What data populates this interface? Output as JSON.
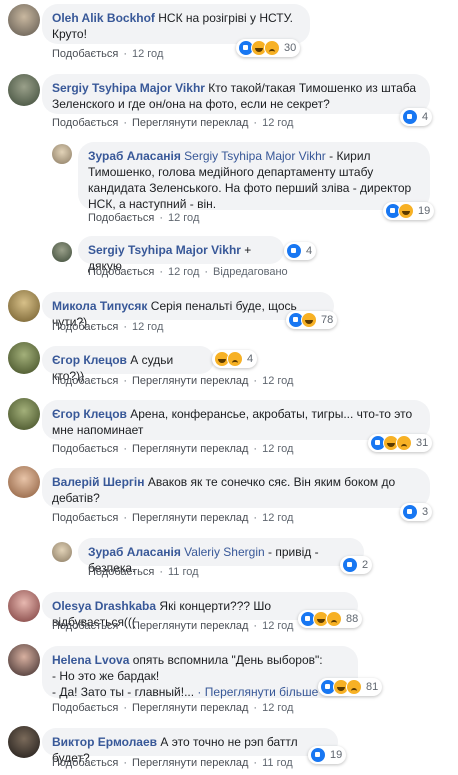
{
  "common": {
    "like": "Подобається",
    "translate": "Переглянути переклад",
    "dot": "·",
    "edited": "Відредаговано",
    "see_more": "Переглянути більше"
  },
  "colors": {
    "link": "#385898",
    "bubble": "#f2f3f5",
    "like": "#1877f2",
    "emoji": "#f7b125"
  },
  "comments": [
    {
      "author": "Oleh Alik Bockhof",
      "text1": "НСК на розігріві у НСТУ.",
      "text2": "Круто!",
      "time": "12 год",
      "reactions": "30",
      "icons": [
        "like-icon",
        "haha-icon",
        "sad-icon"
      ]
    },
    {
      "author": "Sergiy Tsyhipa Major Vikhr",
      "text1": "Кто такой/такая Тимошенко из штаба",
      "text2": "Зеленского и где он/она на фото, если не секрет?",
      "time": "12 год",
      "reactions": "4",
      "icons": [
        "like-icon"
      ]
    },
    {
      "author": "Зураб Аласанія",
      "mention": "Sergiy Tsyhipa Major Vikhr",
      "text1": " - Кирил",
      "text2": "Тимошенко, голова медійного департаменту штабу",
      "text3": "кандидата Зеленського. На фото перший зліва - директор",
      "text4": "НСК, а наступний - він.",
      "time": "12 год",
      "reactions": "19",
      "icons": [
        "like-icon",
        "haha-icon"
      ]
    },
    {
      "author": "Sergiy Tsyhipa Major Vikhr",
      "text1": " + дякую",
      "time": "12 год",
      "reactions": "4",
      "icons": [
        "like-icon"
      ]
    },
    {
      "author": "Микола Типусяк",
      "text1": " Серія пенальті буде, щось чути?)",
      "time": "12 год",
      "reactions": "78",
      "icons": [
        "like-icon",
        "haha-icon"
      ]
    },
    {
      "author": "Єгор Клецов",
      "text1": " А судьи кто?))",
      "time": "12 год",
      "reactions": "4",
      "icons": [
        "haha-icon",
        "sad-icon"
      ]
    },
    {
      "author": "Єгор Клецов",
      "text1": " Арена, конферансье, акробаты, тигры... что-то это",
      "text2": "мне напоминает",
      "time": "12 год",
      "reactions": "31",
      "icons": [
        "like-icon",
        "haha-icon",
        "sad-icon"
      ]
    },
    {
      "author": "Валерій Шергін",
      "text1": " Аваков як те сонечко сяє. Він яким боком до",
      "text2": "дебатів?",
      "time": "12 год",
      "reactions": "3",
      "icons": [
        "like-icon"
      ]
    },
    {
      "author": "Зураб Аласанія",
      "mention": "Valeriy Shergin",
      "text1": " - привід - безпека.",
      "time": "11 год",
      "reactions": "2",
      "icons": [
        "like-icon"
      ]
    },
    {
      "author": "Olesya Drashkaba",
      "text1": " Які концерти??? Шо відбувається(((",
      "time": "12 год",
      "reactions": "88",
      "icons": [
        "like-icon",
        "haha-icon",
        "sad-icon"
      ]
    },
    {
      "author": "Helena Lvova",
      "text1": " опять вспомнила \"День выборов\":",
      "text2": "- Но это же бардак!",
      "text3": "- Да! Зато ты - главный!...",
      "time": "12 год",
      "reactions": "81",
      "icons": [
        "like-icon",
        "haha-icon",
        "sad-icon"
      ]
    },
    {
      "author": "Виктор Ермолаев",
      "text1": " А это точно не рэп баттл будет?",
      "time": "11 год",
      "reactions": "19",
      "icons": [
        "like-icon"
      ]
    }
  ]
}
